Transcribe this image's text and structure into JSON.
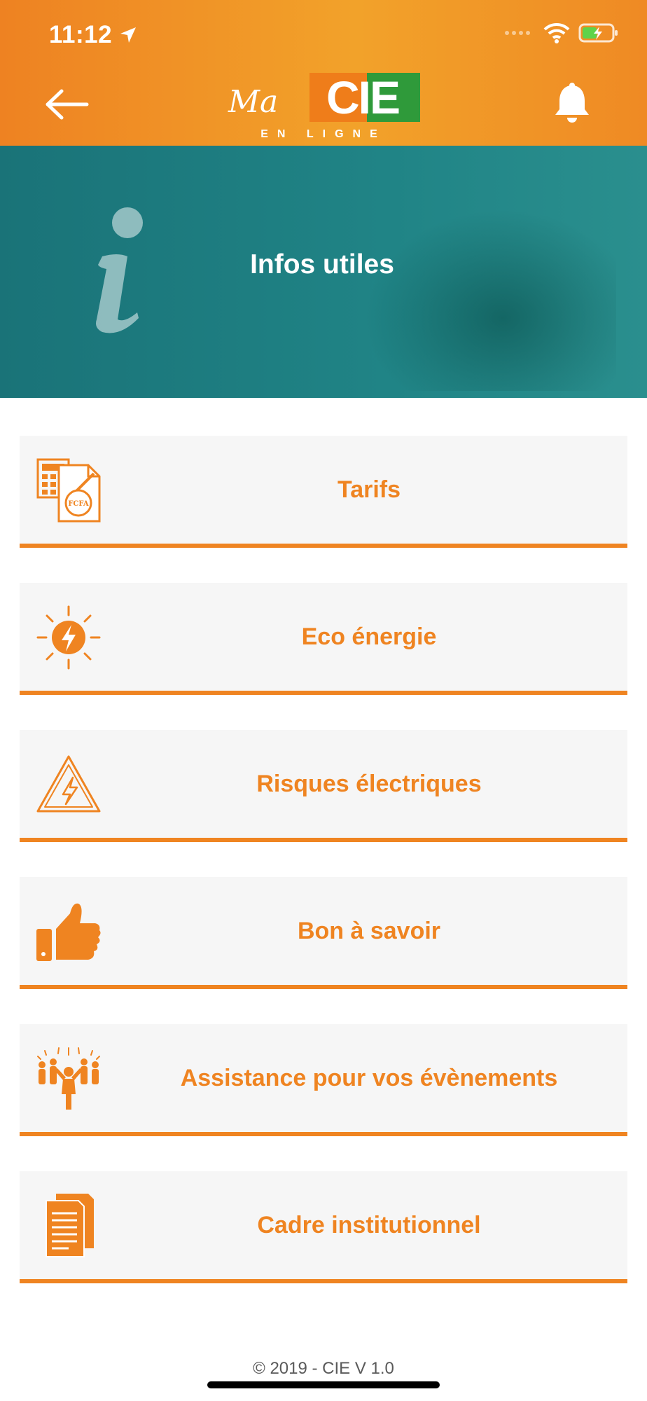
{
  "status_bar": {
    "time": "11:12"
  },
  "header": {
    "logo": {
      "script_text": "Ma",
      "brand": "CIE",
      "tagline": "EN LIGNE"
    },
    "colors": {
      "orange": "#ef8421",
      "green": "#2f9a3a",
      "white": "#ffffff"
    }
  },
  "banner": {
    "title": "Infos utiles"
  },
  "menu": {
    "items": [
      {
        "label": "Tarifs",
        "icon": "tariff-calculator-icon",
        "icon_text": "FCFA"
      },
      {
        "label": "Eco énergie",
        "icon": "sun-bolt-icon"
      },
      {
        "label": "Risques électriques",
        "icon": "electric-warning-icon"
      },
      {
        "label": "Bon à savoir",
        "icon": "thumbs-up-icon"
      },
      {
        "label": "Assistance pour vos évènements",
        "icon": "event-crowd-icon"
      },
      {
        "label": "Cadre institutionnel",
        "icon": "documents-icon"
      }
    ]
  },
  "footer": {
    "text": "© 2019 - CIE V 1.0"
  }
}
